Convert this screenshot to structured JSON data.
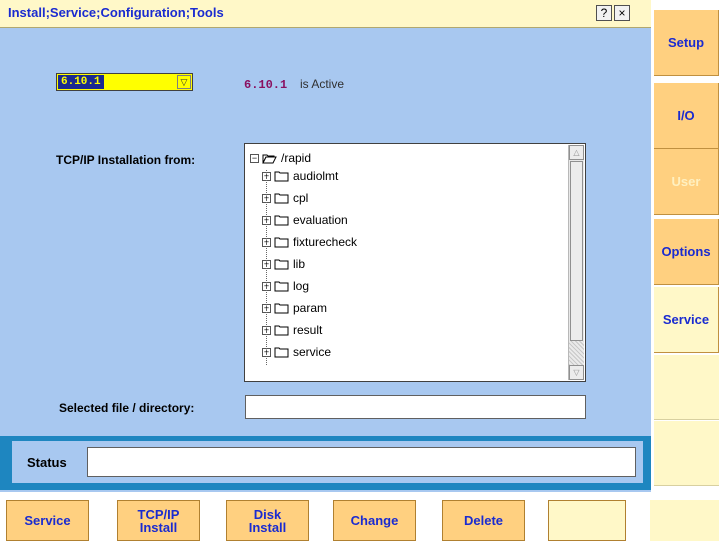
{
  "window": {
    "title": "Install;Service;Configuration;Tools",
    "help_label": "?",
    "close_label": "×"
  },
  "version": {
    "selected": "6.10.1",
    "active_version": "6.10.1",
    "active_text": "is Active"
  },
  "labels": {
    "tcpip_from": "TCP/IP Installation from:",
    "selected_file": "Selected file / directory:",
    "status": "Status"
  },
  "tree": {
    "root": "/rapid",
    "items": [
      "audiolmt",
      "cpl",
      "evaluation",
      "fixturecheck",
      "lib",
      "log",
      "param",
      "result",
      "service"
    ]
  },
  "selected_path": "",
  "status_text": "",
  "side_tabs": [
    "Setup",
    "I/O",
    "User",
    "Options",
    "Service"
  ],
  "bottom_buttons": [
    "Service",
    "TCP/IP\nInstall",
    "Disk\nInstall",
    "Change",
    "Delete"
  ],
  "colors": {
    "accent": "#1a2bd0",
    "background": "#a8c8f0",
    "button": "#ffd080",
    "disabled": "#fff0c0"
  }
}
